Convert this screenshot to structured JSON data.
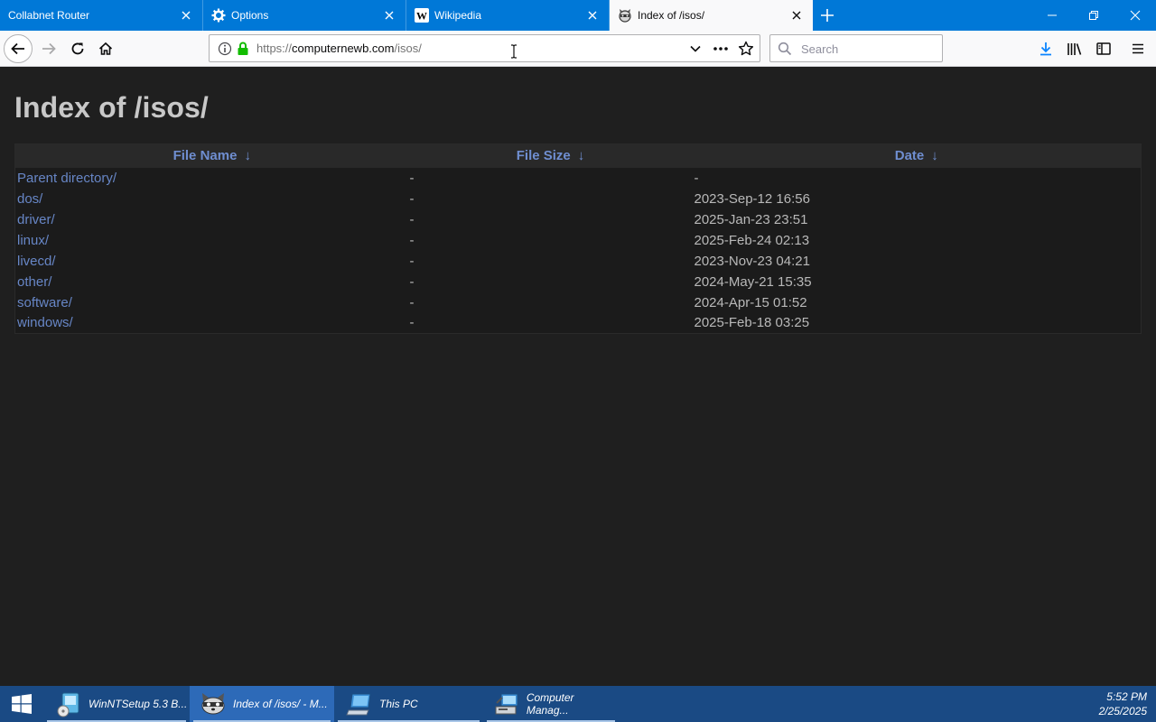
{
  "browser": {
    "tabs": [
      {
        "title": "Collabnet Router",
        "icon": "none",
        "active": false
      },
      {
        "title": "Options",
        "icon": "gear-icon",
        "active": false
      },
      {
        "title": "Wikipedia",
        "icon": "wikipedia-icon",
        "active": false
      },
      {
        "title": "Index of /isos/",
        "icon": "raccoon-favicon-icon",
        "active": true
      }
    ],
    "url": {
      "prefix": "https://",
      "host": "computernewb.com",
      "path": "/isos/"
    },
    "search_placeholder": "Search",
    "accent_color": "#0078d7"
  },
  "page": {
    "title": "Index of /isos/",
    "columns": [
      {
        "label": "File Name",
        "arrow": "↓"
      },
      {
        "label": "File Size",
        "arrow": "↓"
      },
      {
        "label": "Date",
        "arrow": "↓"
      }
    ],
    "rows": [
      {
        "name": "Parent directory/",
        "size": "-",
        "date": "-"
      },
      {
        "name": "dos/",
        "size": "-",
        "date": "2023-Sep-12 16:56"
      },
      {
        "name": "driver/",
        "size": "-",
        "date": "2025-Jan-23 23:51"
      },
      {
        "name": "linux/",
        "size": "-",
        "date": "2025-Feb-24 02:13"
      },
      {
        "name": "livecd/",
        "size": "-",
        "date": "2023-Nov-23 04:21"
      },
      {
        "name": "other/",
        "size": "-",
        "date": "2024-May-21 15:35"
      },
      {
        "name": "software/",
        "size": "-",
        "date": "2024-Apr-15 01:52"
      },
      {
        "name": "windows/",
        "size": "-",
        "date": "2025-Feb-18 03:25"
      }
    ],
    "link_color": "#6786c6",
    "background_color": "#1f1f1f"
  },
  "taskbar": {
    "items": [
      {
        "label": "WinNTSetup 5.3 B...",
        "icon": "winntsetup-icon",
        "active": false
      },
      {
        "label": "Index of /isos/ - M...",
        "icon": "firefox-raccoon-icon",
        "active": true
      },
      {
        "label": "This PC",
        "icon": "this-pc-icon",
        "active": false
      },
      {
        "label": "Computer Manag...",
        "icon": "computer-management-icon",
        "active": false
      }
    ],
    "time": "5:52 PM",
    "date": "2/25/2025",
    "background_color": "#1a4a84"
  }
}
